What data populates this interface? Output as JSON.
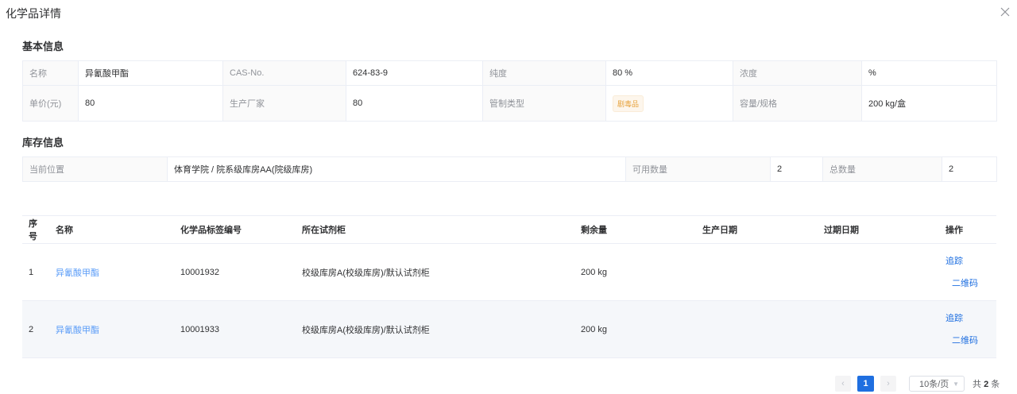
{
  "dialog": {
    "title": "化学品详情"
  },
  "basic": {
    "section_title": "基本信息",
    "name_label": "名称",
    "name_value": "异氰酸甲酯",
    "cas_label": "CAS-No.",
    "cas_value": "624-83-9",
    "purity_label": "纯度",
    "purity_value": "80 %",
    "concentration_label": "浓度",
    "concentration_value": "%",
    "price_label": "单价(元)",
    "price_value": "80",
    "maker_label": "生产厂家",
    "maker_value": "80",
    "control_label": "管制类型",
    "control_value": "剧毒品",
    "capacity_label": "容量/规格",
    "capacity_value": "200 kg/盒"
  },
  "stock": {
    "section_title": "库存信息",
    "location_label": "当前位置",
    "location_value": "体育学院 / 院系级库房AA(院级库房)",
    "available_label": "可用数量",
    "available_value": "2",
    "total_label": "总数量",
    "total_value": "2"
  },
  "table": {
    "headers": [
      "序号",
      "名称",
      "化学品标签编号",
      "所在试剂柜",
      "剩余量",
      "生产日期",
      "过期日期",
      "操作"
    ],
    "rows": [
      {
        "index": "1",
        "name": "异氰酸甲酯",
        "label_no": "10001932",
        "cabinet": "校级库房A(校级库房)/默认试剂柜",
        "remaining": "200 kg",
        "production_date": "",
        "expiry_date": "",
        "op_trace": "追踪",
        "op_qr": "二维码"
      },
      {
        "index": "2",
        "name": "异氰酸甲酯",
        "label_no": "10001933",
        "cabinet": "校级库房A(校级库房)/默认试剂柜",
        "remaining": "200 kg",
        "production_date": "",
        "expiry_date": "",
        "op_trace": "追踪",
        "op_qr": "二维码"
      }
    ]
  },
  "pagination": {
    "prev": "‹",
    "next": "›",
    "current_page": "1",
    "page_size": "10条/页",
    "total_prefix": "共",
    "total_count": "2",
    "total_suffix": "条"
  },
  "icons": {
    "close": "close-icon",
    "prev": "chevron-left-icon",
    "next": "chevron-right-icon",
    "dropdown": "chevron-down-icon"
  },
  "colors": {
    "primary": "#1f6fe0",
    "link": "#5a9cf8",
    "warning": "#e6a23c",
    "label_bg": "#fafafa",
    "stripe_bg": "#f5f7fa"
  }
}
